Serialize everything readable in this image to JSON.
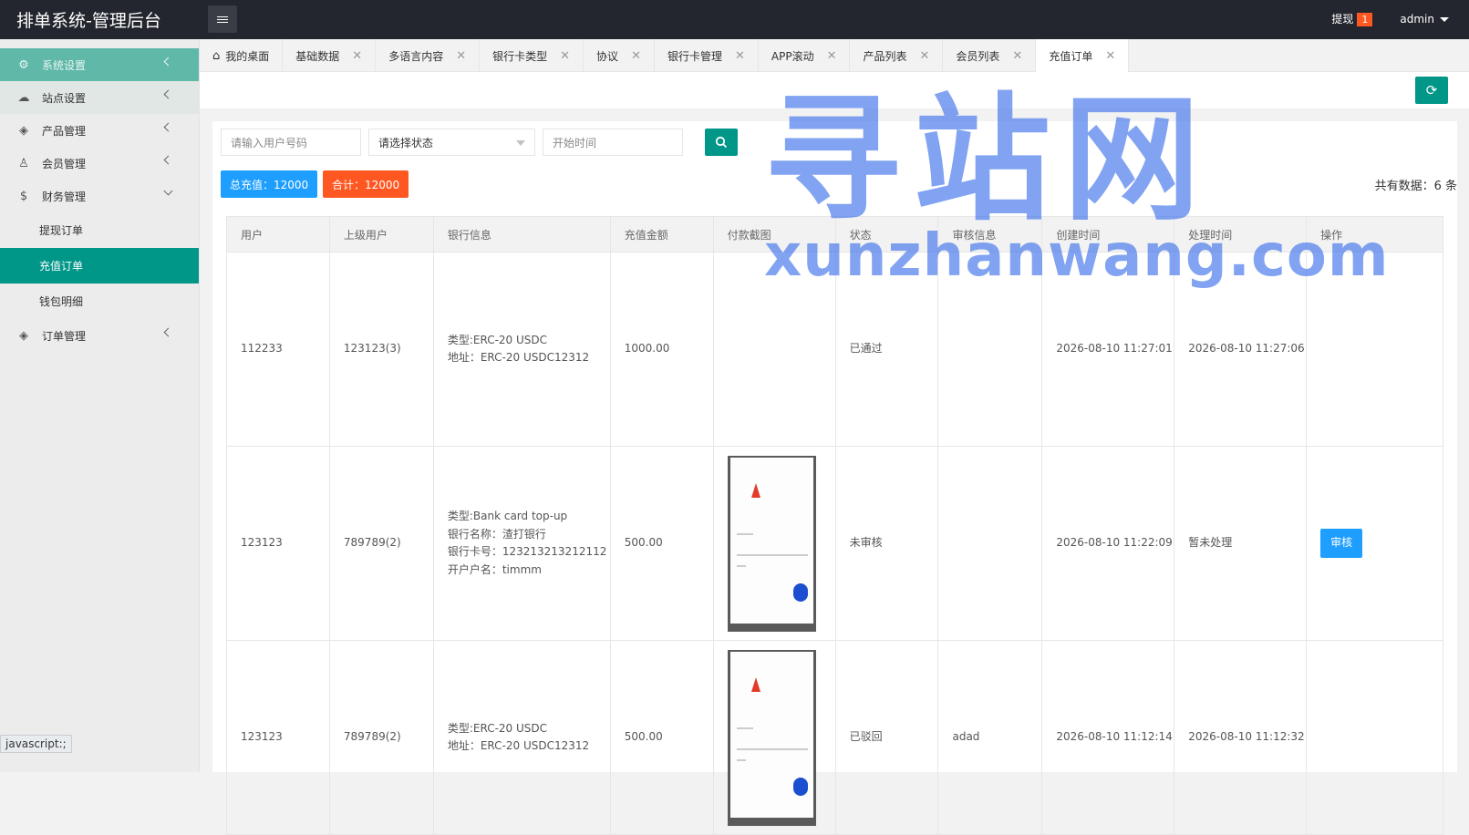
{
  "app": {
    "title": "排单系统-管理后台"
  },
  "topbar": {
    "withdraw_label": "提现",
    "withdraw_count": "1",
    "user": "admin"
  },
  "sidebar": {
    "items": [
      {
        "label": "系统设置",
        "icon": "gear-icon"
      },
      {
        "label": "站点设置",
        "icon": "cloud-icon"
      },
      {
        "label": "产品管理",
        "icon": "cube-icon"
      },
      {
        "label": "会员管理",
        "icon": "user-icon"
      },
      {
        "label": "财务管理",
        "icon": "dollar-icon"
      },
      {
        "label": "订单管理",
        "icon": "cube-icon"
      }
    ],
    "finance_sub": [
      "提现订单",
      "充值订单",
      "钱包明细"
    ]
  },
  "tabs": [
    "我的桌面",
    "基础数据",
    "多语言内容",
    "银行卡类型",
    "协议",
    "银行卡管理",
    "APP滚动",
    "产品列表",
    "会员列表",
    "充值订单"
  ],
  "filters": {
    "user_placeholder": "请输入用户号码",
    "status_label": "请选择状态",
    "time_placeholder": "开始时间"
  },
  "summary": {
    "total_recharge": "总充值：12000",
    "sum": "合计：12000",
    "count_text": "共有数据：6 条"
  },
  "colors": {
    "primary": "#009688",
    "blue": "#1e9fff",
    "orange": "#ff5722"
  },
  "table": {
    "headers": [
      "用户",
      "上级用户",
      "银行信息",
      "充值金额",
      "付款截图",
      "状态",
      "审核信息",
      "创建时间",
      "处理时间",
      "操作"
    ],
    "rows": [
      {
        "user": "112233",
        "parent": "123123(3)",
        "bank": [
          "类型:ERC-20 USDC",
          "地址：ERC-20 USDC12312"
        ],
        "amount": "1000.00",
        "status": "已通过",
        "review": "",
        "created": "2026-08-10 11:27:01",
        "processed": "2026-08-10 11:27:06",
        "action": ""
      },
      {
        "user": "123123",
        "parent": "789789(2)",
        "bank": [
          "类型:Bank card top-up",
          "银行名称：渣打银行",
          "银行卡号：123213213212112",
          "开户户名：timmm"
        ],
        "amount": "500.00",
        "status": "未审核",
        "review": "",
        "created": "2026-08-10 11:22:09",
        "processed": "暂未处理",
        "action": "审核"
      },
      {
        "user": "123123",
        "parent": "789789(2)",
        "bank": [
          "类型:ERC-20 USDC",
          "地址：ERC-20 USDC12312"
        ],
        "amount": "500.00",
        "status": "已驳回",
        "review": "adad",
        "created": "2026-08-10 11:12:14",
        "processed": "2026-08-10 11:12:32",
        "action": ""
      }
    ]
  },
  "watermark": {
    "big": "寻站网",
    "small": "xunzhanwang.com"
  },
  "statusbar": "javascript:;"
}
